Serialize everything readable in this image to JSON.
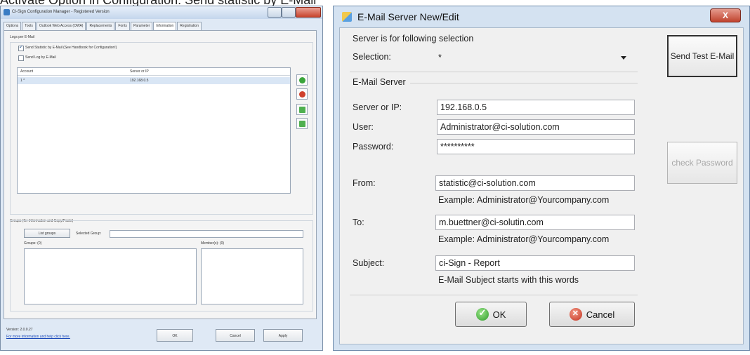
{
  "caption": "Activate Option in Configuration: Send statistic by E-Mail",
  "config_window": {
    "title": "CI-Sign Configuration Manager - Registered Version",
    "tabs": [
      "Options",
      "Tools",
      "Outlook Web Access (OWA)",
      "Replacements",
      "Fonts",
      "Parameter",
      "Information",
      "Registration"
    ],
    "section_label": "Logs per E-Mail",
    "checkbox_stats": "Send Statistic by E-Mail (See Handbook for Configuration!)",
    "checkbox_log": "Send Log by E-Mail",
    "list_col_account": "Account",
    "list_col_server": "Server or IP",
    "row_account": "1  *",
    "row_server": "192.168.0.5",
    "groups_label": "Groups (for Information and Copy/Paste)",
    "list_groups_btn": "List groups",
    "selected_group_label": "Selected Group:",
    "groups_count_label": "Groups: (0)",
    "members_label": "Member(s): (0)",
    "version": "Version: 2.0.0.27",
    "help_link": "For more information and help click here.",
    "ok": "OK",
    "cancel": "Cancel",
    "apply": "Apply"
  },
  "dialog": {
    "title": "E-Mail Server New/Edit",
    "close": "X",
    "selection_section": "Server is for following selection",
    "selection_label": "Selection:",
    "selection_value": "*",
    "server_section": "E-Mail Server",
    "server_label": "Server or IP:",
    "server_value": "192.168.0.5",
    "user_label": "User:",
    "user_value": "Administrator@ci-solution.com",
    "password_label": "Password:",
    "password_value": "**********",
    "from_label": "From:",
    "from_value": "statistic@ci-solution.com",
    "from_hint": "Example: Administrator@Yourcompany.com",
    "to_label": "To:",
    "to_value": "m.buettner@ci-solutin.com",
    "to_hint": "Example: Administrator@Yourcompany.com",
    "subject_label": "Subject:",
    "subject_value": "ci-Sign - Report",
    "subject_hint": "E-Mail Subject starts with this words",
    "send_test": "Send Test E-Mail",
    "check_password": "check Password",
    "ok": "OK",
    "cancel": "Cancel"
  }
}
